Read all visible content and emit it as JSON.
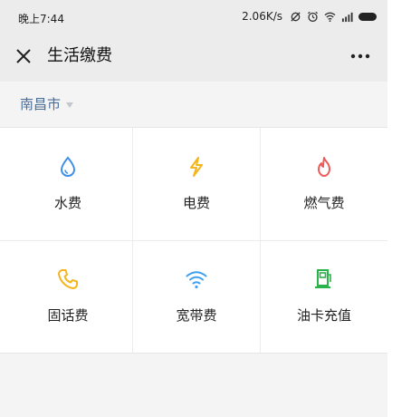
{
  "status_bar": {
    "time": "晚上7:44",
    "speed": "2.06K/s",
    "icons": [
      "sync-off-icon",
      "alarm-icon",
      "wifi-icon",
      "signal-icon",
      "battery-icon"
    ]
  },
  "nav": {
    "close_icon": "close-icon",
    "title": "生活缴费",
    "more_icon": "more-dots-icon"
  },
  "city": {
    "name": "南昌市",
    "dropdown_icon": "triangle-down-icon",
    "color": "#4a6d98"
  },
  "services": [
    {
      "label": "水费",
      "icon": "water-drop-icon",
      "color": "#3e8ee8"
    },
    {
      "label": "电费",
      "icon": "lightning-icon",
      "color": "#f5b51c"
    },
    {
      "label": "燃气费",
      "icon": "flame-icon",
      "color": "#ee5a5a"
    },
    {
      "label": "固话费",
      "icon": "phone-icon",
      "color": "#f5b51c"
    },
    {
      "label": "宽带费",
      "icon": "wifi-icon",
      "color": "#3fa0f0"
    },
    {
      "label": "油卡充值",
      "icon": "fuel-pump-icon",
      "color": "#2bb34b"
    }
  ]
}
